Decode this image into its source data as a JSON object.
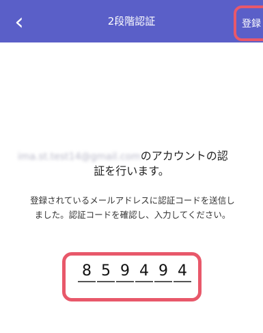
{
  "nav": {
    "back_icon": "chevron-left-icon",
    "title": "2段階認証",
    "register_label": "登録"
  },
  "verification": {
    "email_masked": "ima.st.test14@gmail.com",
    "account_text": "のアカウントの認",
    "account_text_line2": "証を行います。",
    "message_line1": "登録されているメールアドレスに認証コードを送信し",
    "message_line2": "ました。認証コードを確認し、入力してください。",
    "code_digits": [
      "8",
      "5",
      "9",
      "4",
      "9",
      "4"
    ]
  },
  "colors": {
    "navbar": "#5a5fc8",
    "highlight": "#e8586a"
  }
}
